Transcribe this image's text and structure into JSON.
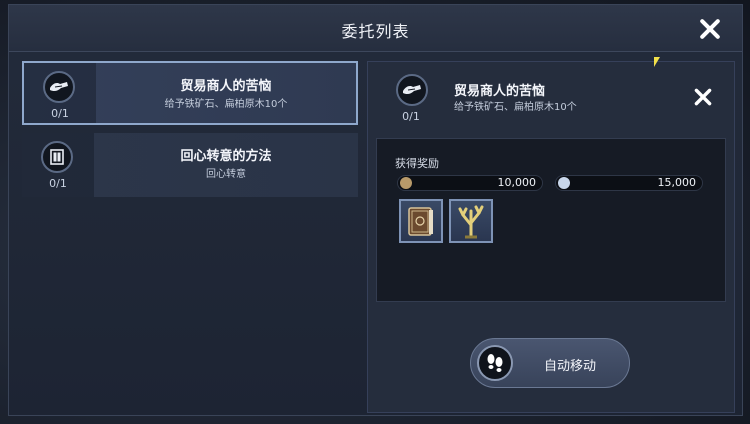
{
  "window": {
    "title": "委托列表"
  },
  "quests": [
    {
      "title": "贸易商人的苦恼",
      "subtitle": "给予铁矿石、扁柏原木10个",
      "progress": "0/1",
      "icon": "handshake-icon",
      "selected": true
    },
    {
      "title": "回心转意的方法",
      "subtitle": "回心转意",
      "progress": "0/1",
      "icon": "door-icon",
      "selected": false
    }
  ],
  "detail": {
    "title": "贸易商人的苦恼",
    "subtitle": "给予铁矿石、扁柏原木10个",
    "progress": "0/1",
    "icon": "handshake-icon",
    "rewards_label": "获得奖励",
    "currencies": [
      {
        "icon": "gold-coin-icon",
        "value": "10,000",
        "color": "#b89a6a"
      },
      {
        "icon": "silver-coin-icon",
        "value": "15,000",
        "color": "#c8d6ea"
      }
    ],
    "items": [
      {
        "icon": "book-icon"
      },
      {
        "icon": "coral-icon"
      }
    ],
    "auto_move_label": "自动移动"
  },
  "colors": {
    "selected_border": "#8fa8cc",
    "panel": "#252d3d",
    "reward_bg": "#161b25"
  }
}
